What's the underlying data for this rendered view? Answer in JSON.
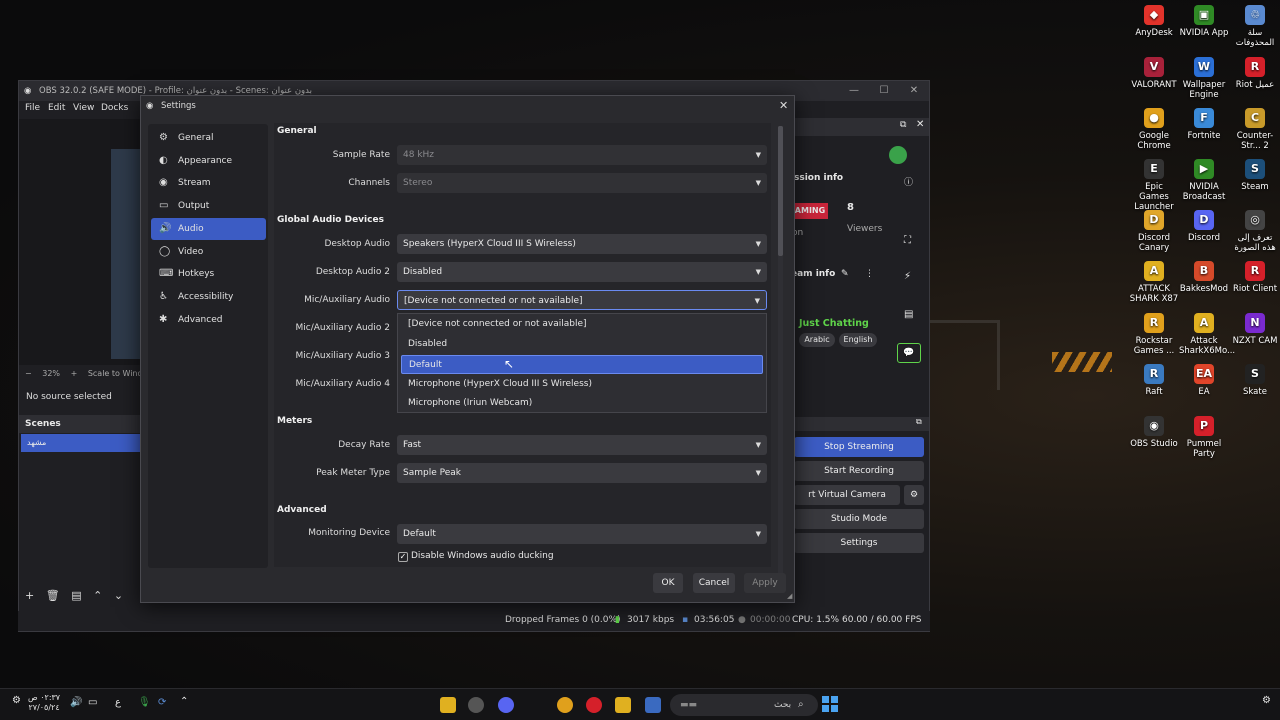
{
  "desktop_icons": [
    {
      "label": "AnyDesk",
      "color": "#e2332b",
      "glyph": "◆"
    },
    {
      "label": "NVIDIA App",
      "color": "#2f8a25",
      "glyph": "▣"
    },
    {
      "label": "سلة المحذوفات",
      "color": "#5a8ad0",
      "glyph": "♲"
    },
    {
      "label": "VALORANT",
      "color": "#a8213a",
      "glyph": "V"
    },
    {
      "label": "Wallpaper Engine",
      "color": "#2b6fd6",
      "glyph": "W"
    },
    {
      "label": "Riot عميل",
      "color": "#d5202a",
      "glyph": "R"
    },
    {
      "label": "Google Chrome",
      "color": "#e0a01c",
      "glyph": "●"
    },
    {
      "label": "Fortnite",
      "color": "#3a8ad8",
      "glyph": "F"
    },
    {
      "label": "Counter-Str... 2",
      "color": "#c89a2a",
      "glyph": "C"
    },
    {
      "label": "Epic Games Launcher",
      "color": "#333",
      "glyph": "E"
    },
    {
      "label": "NVIDIA Broadcast",
      "color": "#2f8a25",
      "glyph": "▶"
    },
    {
      "label": "Steam",
      "color": "#1c4f7a",
      "glyph": "S"
    },
    {
      "label": "Discord Canary",
      "color": "#e0a62a",
      "glyph": "D"
    },
    {
      "label": "Discord",
      "color": "#5865f2",
      "glyph": "D"
    },
    {
      "label": "تعرف إلى هذه الصورة",
      "color": "#444",
      "glyph": "◎"
    },
    {
      "label": "ATTACK SHARK X87",
      "color": "#e0b020",
      "glyph": "A"
    },
    {
      "label": "BakkesMod",
      "color": "#d54a2a",
      "glyph": "B"
    },
    {
      "label": "Riot Client",
      "color": "#d5202a",
      "glyph": "R"
    },
    {
      "label": "Rockstar Games ...",
      "color": "#e0a01c",
      "glyph": "R"
    },
    {
      "label": "Attack SharkX6Mo...",
      "color": "#e0b020",
      "glyph": "A"
    },
    {
      "label": "NZXT CAM",
      "color": "#7a2ad0",
      "glyph": "N"
    },
    {
      "label": "Raft",
      "color": "#3a7ac0",
      "glyph": "R"
    },
    {
      "label": "EA",
      "color": "#e0452a",
      "glyph": "EA"
    },
    {
      "label": "Skate",
      "color": "#222",
      "glyph": "S"
    },
    {
      "label": "OBS Studio",
      "color": "#333",
      "glyph": "◉"
    },
    {
      "label": "Pummel Party",
      "color": "#d5202a",
      "glyph": "P"
    }
  ],
  "obs": {
    "title": "OBS 32.0.2 (SAFE MODE) - Profile: بدون عنوان - Scenes: بدون عنوان",
    "menu": [
      "File",
      "Edit",
      "View",
      "Docks"
    ],
    "zoom": "32%",
    "scale_label": "Scale to Window",
    "no_source": "No source selected",
    "scenes_title": "Scenes",
    "scene_item": "مشهد",
    "stream_info": "ssion info",
    "live_badge": "AMING",
    "viewers_count": "8",
    "viewers_label": "Viewers",
    "on_label": "on",
    "team_info": "eam info",
    "category": "Just Chatting",
    "tags": [
      "Arabic",
      "English"
    ],
    "controls": {
      "stop_streaming": "Stop Streaming",
      "start_recording": "Start Recording",
      "virtual_camera": "rt Virtual Camera",
      "studio_mode": "Studio Mode",
      "settings": "Settings"
    },
    "status": {
      "dropped": "Dropped Frames 0 (0.0%)",
      "kbps": "3017 kbps",
      "stream_time": "03:56:05",
      "rec_time": "00:00:00",
      "cpu": "CPU: 1.5%",
      "fps": "60.00 / 60.00 FPS"
    }
  },
  "settings": {
    "title": "Settings",
    "sidebar": [
      {
        "label": "General",
        "icon": "⚙"
      },
      {
        "label": "Appearance",
        "icon": "◐"
      },
      {
        "label": "Stream",
        "icon": "((·))"
      },
      {
        "label": "Output",
        "icon": "▭"
      },
      {
        "label": "Audio",
        "icon": "🔊"
      },
      {
        "label": "Video",
        "icon": "◯"
      },
      {
        "label": "Hotkeys",
        "icon": "⌨"
      },
      {
        "label": "Accessibility",
        "icon": "♿"
      },
      {
        "label": "Advanced",
        "icon": "✱"
      }
    ],
    "active_item": "Audio",
    "general_title": "General",
    "sample_rate_label": "Sample Rate",
    "sample_rate_value": "48 kHz",
    "channels_label": "Channels",
    "channels_value": "Stereo",
    "global_title": "Global Audio Devices",
    "desktop_audio_label": "Desktop Audio",
    "desktop_audio_value": "Speakers (HyperX Cloud III S Wireless)",
    "desktop_audio2_label": "Desktop Audio 2",
    "desktop_audio2_value": "Disabled",
    "mic_label": "Mic/Auxiliary Audio",
    "mic_value": "[Device not connected or not available]",
    "mic2_label": "Mic/Auxiliary Audio 2",
    "mic3_label": "Mic/Auxiliary Audio 3",
    "mic4_label": "Mic/Auxiliary Audio 4",
    "dropdown_options": [
      "[Device not connected or not available]",
      "Disabled",
      "Default",
      "Microphone (HyperX Cloud III S Wireless)",
      "Microphone (Iriun Webcam)"
    ],
    "dropdown_selected": "Default",
    "meters_title": "Meters",
    "decay_label": "Decay Rate",
    "decay_value": "Fast",
    "peak_label": "Peak Meter Type",
    "peak_value": "Sample Peak",
    "advanced_title": "Advanced",
    "monitoring_label": "Monitoring Device",
    "monitoring_value": "Default",
    "ducking_label": "Disable Windows audio ducking",
    "ducking_checked": true,
    "ok": "OK",
    "cancel": "Cancel",
    "apply": "Apply"
  },
  "taskbar": {
    "search_placeholder": "بحث",
    "time": "٠٢:٣٧ ص",
    "date": "٢٧/٠٥/٢٤",
    "lang": "ع"
  }
}
